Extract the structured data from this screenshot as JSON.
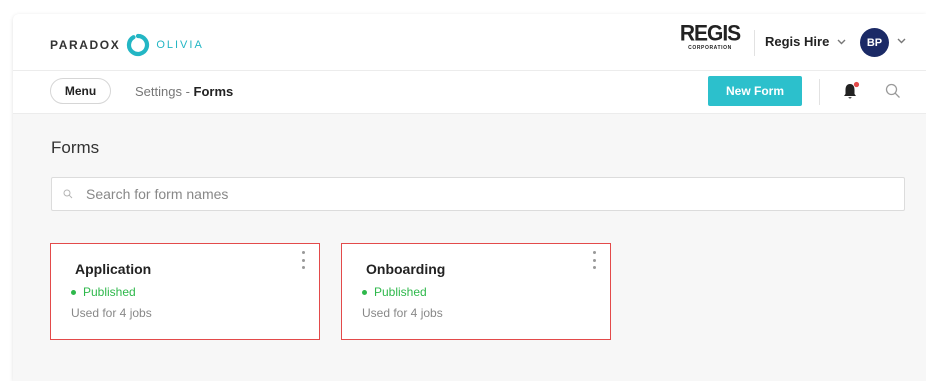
{
  "brand": {
    "left": "PARADOX",
    "right": "OLIVIA",
    "accent": "#23b6c4"
  },
  "corp": {
    "word": "REGIS",
    "sub": "CORPORATION"
  },
  "account": {
    "name": "Regis Hire",
    "initials": "BP",
    "avatar_color": "#1b2a66"
  },
  "nav": {
    "menu_label": "Menu",
    "breadcrumb_parent": "Settings",
    "breadcrumb_sep": " - ",
    "breadcrumb_current": "Forms"
  },
  "actions": {
    "new_form_label": "New Form",
    "button_color": "#2cc0cc",
    "notification_dot_color": "#e34a4a"
  },
  "page": {
    "title": "Forms"
  },
  "search": {
    "placeholder": "Search for form names",
    "value": ""
  },
  "forms": [
    {
      "name": "Application",
      "status": "Published",
      "usage": "Used for 4 jobs"
    },
    {
      "name": "Onboarding",
      "status": "Published",
      "usage": "Used for 4 jobs"
    }
  ],
  "icons": [
    "logo-icon",
    "chevron-down-icon",
    "bell-icon",
    "search-icon",
    "kebab-menu-icon",
    "status-dot-icon"
  ]
}
